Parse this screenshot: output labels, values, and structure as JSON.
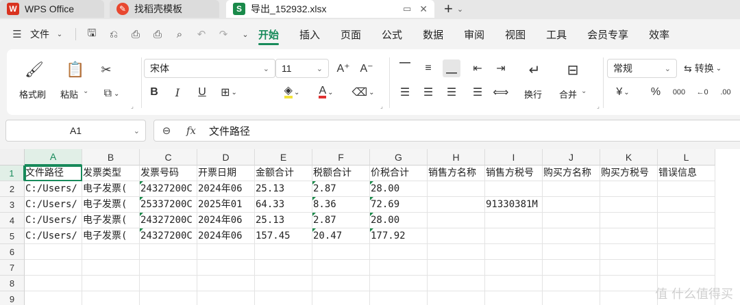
{
  "tabs": [
    {
      "label": "WPS Office",
      "icon": "wps-logo-icon"
    },
    {
      "label": "找稻壳模板",
      "icon": "template-icon"
    },
    {
      "label": "导出_152932.xlsx",
      "icon": "spreadsheet-icon"
    }
  ],
  "menu": {
    "file_label": "文件",
    "tabs": [
      "开始",
      "插入",
      "页面",
      "公式",
      "数据",
      "审阅",
      "视图",
      "工具",
      "会员专享",
      "效率"
    ],
    "active_tab": "开始"
  },
  "ribbon": {
    "format_painter": "格式刷",
    "paste": "粘贴",
    "font_name": "宋体",
    "font_size": "11",
    "wrap": "换行",
    "merge": "合并",
    "number_format": "常规",
    "convert": "转换",
    "currency_symbol": "¥",
    "percent_symbol": "%",
    "thousands_symbol": "000"
  },
  "formula_bar": {
    "name_box": "A1",
    "fx_label": "fx",
    "value": "文件路径"
  },
  "grid": {
    "columns": [
      "A",
      "B",
      "C",
      "D",
      "E",
      "F",
      "G",
      "H",
      "I",
      "J",
      "K",
      "L"
    ],
    "rows": [
      "1",
      "2",
      "3",
      "4",
      "5",
      "6",
      "7",
      "8",
      "9"
    ],
    "cells": [
      [
        "文件路径",
        "发票类型",
        "发票号码",
        "开票日期",
        "金额合计",
        "税额合计",
        "价税合计",
        "销售方名称",
        "销售方税号",
        "购买方名称",
        "购买方税号",
        "错误信息"
      ],
      [
        "C:/Users/",
        "电子发票(",
        "24327200C",
        "2024年06",
        "25.13",
        "2.87",
        "28.00",
        "",
        "",
        "",
        "",
        ""
      ],
      [
        "C:/Users/",
        "电子发票(",
        "25337200C",
        "2025年01",
        "64.33",
        "8.36",
        "72.69",
        "",
        "91330381M",
        "",
        "",
        ""
      ],
      [
        "C:/Users/",
        "电子发票(",
        "24327200C",
        "2024年06",
        "25.13",
        "2.87",
        "28.00",
        "",
        "",
        "",
        "",
        ""
      ],
      [
        "C:/Users/",
        "电子发票(",
        "24327200C",
        "2024年06",
        "157.45",
        "20.47",
        "177.92",
        "",
        "",
        "",
        "",
        ""
      ]
    ]
  },
  "watermark": "值 什么值得买",
  "colors": {
    "accent": "#178a5a",
    "wps_red": "#d9321f",
    "xls_green": "#1a8a4a"
  }
}
